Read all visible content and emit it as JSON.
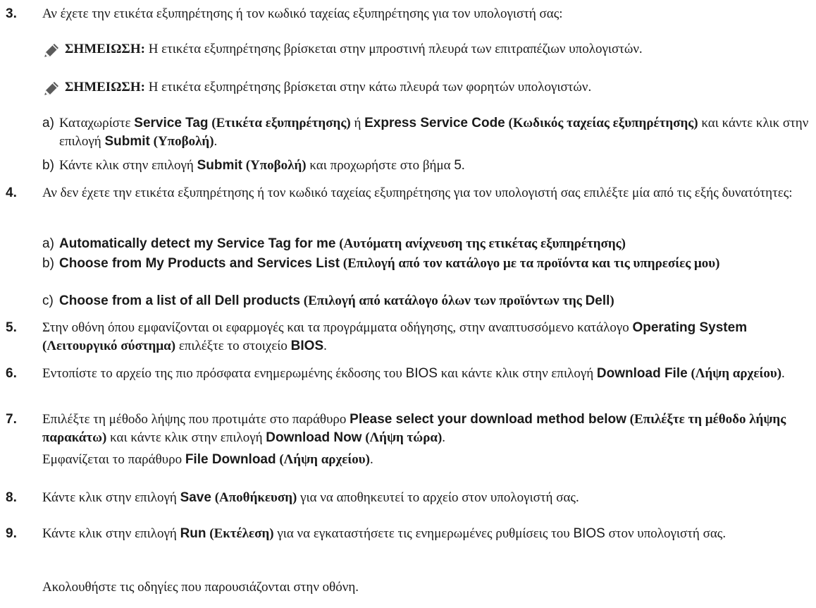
{
  "steps": {
    "s3": {
      "num": "3.",
      "text": "Αν έχετε την ετικέτα εξυπηρέτησης ή τον κωδικό ταχείας εξυπηρέτησης για τον υπολογιστή σας:",
      "notes": [
        {
          "label": "ΣΗΜΕΙΩΣΗ:",
          "text": " Η ετικέτα εξυπηρέτησης βρίσκεται στην μπροστινή πλευρά των επιτραπέζιων υπολογιστών."
        },
        {
          "label": "ΣΗΜΕΙΩΣΗ:",
          "text": " Η ετικέτα εξυπηρέτησης βρίσκεται στην κάτω πλευρά των φορητών υπολογιστών."
        }
      ],
      "sub_a": {
        "label": "a)",
        "t1": "Καταχωρίστε ",
        "b1": "Service Tag",
        "s1": " (Ετικέτα εξυπηρέτησης)",
        "t2": " ή ",
        "b2": "Express Service Code",
        "s2": " (Κωδικός ταχείας εξυπηρέτησης)",
        "t3": " και κάντε κλικ στην επιλογή ",
        "b3": "Submit",
        "s3": " (Υποβολή)",
        "t4": "."
      },
      "sub_b": {
        "label": "b)",
        "t1": "Κάντε κλικ στην επιλογή ",
        "b1": "Submit",
        "s1": " (Υποβολή)",
        "t2": " και προχωρήστε στο βήμα ",
        "n": "5",
        "t3": "."
      }
    },
    "s4": {
      "num": "4.",
      "text": "Αν δεν έχετε την ετικέτα εξυπηρέτησης ή τον κωδικό ταχείας εξυπηρέτησης για τον υπολογιστή σας επιλέξτε μία από τις εξής δυνατότητες:",
      "opt_a": {
        "label": "a)",
        "b": "Automatically detect my Service Tag for me",
        "s": " (Αυτόματη ανίχνευση της ετικέτας εξυπηρέτησης)"
      },
      "opt_b": {
        "label": "b)",
        "b": "Choose from My Products and Services List",
        "s": " (Επιλογή από τον κατάλογο με τα προϊόντα και τις υπηρεσίες μου)"
      },
      "opt_c": {
        "label": "c)",
        "b": "Choose from a list of all Dell products",
        "s": " (Επιλογή από κατάλογο όλων των προϊόντων της ",
        "b2": "Dell",
        "s2": ")"
      }
    },
    "s5": {
      "num": "5.",
      "t1": "Στην οθόνη όπου εμφανίζονται οι εφαρμογές και τα προγράμματα οδήγησης, στην αναπτυσσόμενο κατάλογο ",
      "b1": "Operating System",
      "s1": " (Λειτουργικό σύστημα)",
      "t2": " επιλέξτε το στοιχείο ",
      "b2": "BIOS",
      "t3": "."
    },
    "s6": {
      "num": "6.",
      "t1": "Εντοπίστε το αρχείο της πιο πρόσφατα ενημερωμένης έκδοσης του ",
      "bios": "BIOS",
      "t2": " και κάντε κλικ στην επιλογή ",
      "b1": "Download File",
      "s1": " (Λήψη αρχείου)",
      "t3": "."
    },
    "s7": {
      "num": "7.",
      "t1": "Επιλέξτε τη μέθοδο λήψης που προτιμάτε στο παράθυρο ",
      "b1": "Please select your download method below",
      "s1": " (Επιλέξτε τη μέθοδο λήψης παρακάτω)",
      "t2": " και κάντε κλικ στην επιλογή ",
      "b2": "Download Now",
      "s2": " (Λήψη τώρα)",
      "t3": ".",
      "r1": "Εμφανίζεται το παράθυρο ",
      "rb": "File Download",
      "rs": " (Λήψη αρχείου)",
      "r2": "."
    },
    "s8": {
      "num": "8.",
      "t1": "Κάντε κλικ στην επιλογή ",
      "b1": "Save",
      "s1": " (Αποθήκευση)",
      "t2": " για να αποθηκευτεί το αρχείο στον υπολογιστή σας."
    },
    "s9": {
      "num": "9.",
      "t1": "Κάντε κλικ στην επιλογή ",
      "b1": "Run",
      "s1": " (Εκτέλεση)",
      "t2": " για να εγκαταστήσετε τις ενημερωμένες ρυθμίσεις του ",
      "bios": "BIOS",
      "t3": " στον υπολογιστή σας.",
      "result": "Ακολουθήστε τις οδηγίες που παρουσιάζονται στην οθόνη."
    }
  }
}
